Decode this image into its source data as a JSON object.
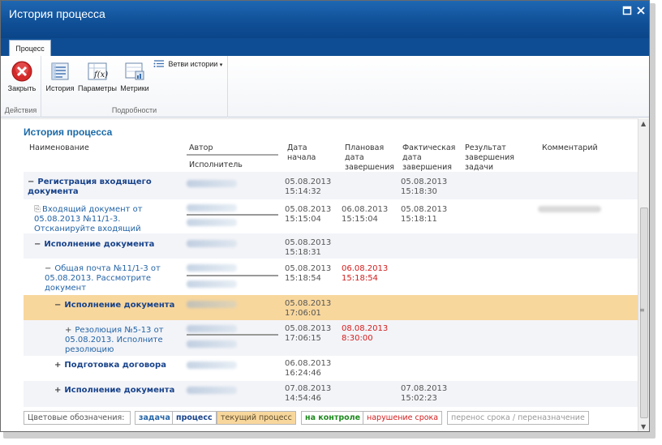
{
  "window": {
    "title": "История процесса"
  },
  "tabs": [
    {
      "label": "Процесс"
    }
  ],
  "ribbon": {
    "groups": [
      {
        "label": "Действия"
      },
      {
        "label": "Подробности"
      }
    ],
    "buttons": {
      "close": "Закрыть",
      "history": "История",
      "params": "Параметры",
      "metrics": "Метрики",
      "branches": "Ветви истории"
    }
  },
  "section_title": "История процесса",
  "columns": {
    "name": "Наименование",
    "author": "Автор",
    "executor": "Исполнитель",
    "start": "Дата начала",
    "planned": "Плановая дата завершения",
    "actual": "Фактическая дата завершения",
    "result": "Результат завершения задачи",
    "comment": "Комментарий"
  },
  "rows": [
    {
      "toggle": "−",
      "name": "Регистрация входящего документа",
      "start": "05.08.2013 15:14:32",
      "planned": "",
      "actual": "05.08.2013 15:18:30",
      "comment": ""
    },
    {
      "toggle": "",
      "name": "Входящий документ от 05.08.2013 №11/1-3. Отсканируйте входящий документ",
      "start": "05.08.2013 15:15:04",
      "planned": "06.08.2013 15:15:04",
      "actual": "05.08.2013 15:18:11",
      "comment": "scan.pnbrapfan"
    },
    {
      "toggle": "−",
      "name": "Исполнение документа",
      "start": "05.08.2013 15:18:31",
      "planned": "",
      "actual": "",
      "comment": ""
    },
    {
      "toggle": "−",
      "name": "Общая почта №11/1-3 от 05.08.2013. Рассмотрите документ",
      "start": "05.08.2013 15:18:54",
      "planned": "06.08.2013 15:18:54",
      "actual": "",
      "comment": ""
    },
    {
      "toggle": "−",
      "name": "Исполнение документа",
      "start": "05.08.2013 17:06:01",
      "planned": "",
      "actual": "",
      "comment": ""
    },
    {
      "toggle": "+",
      "name": "Резолюция №5-13 от 05.08.2013. Исполните резолюцию",
      "start": "05.08.2013 17:06:15",
      "planned": "08.08.2013 8:30:00",
      "actual": "",
      "comment": ""
    },
    {
      "toggle": "+",
      "name": "Подготовка договора",
      "start": "06.08.2013 16:24:46",
      "planned": "",
      "actual": "",
      "comment": ""
    },
    {
      "toggle": "+",
      "name": "Исполнение документа",
      "start": "07.08.2013 14:54:46",
      "planned": "",
      "actual": "07.08.2013 15:02:23",
      "comment": ""
    }
  ],
  "legend": {
    "label": "Цветовые обозначения:",
    "items": [
      {
        "text": "задача",
        "color": "#2464a6"
      },
      {
        "text": "процесс",
        "color": "#17428a"
      },
      {
        "text": "текущий процесс",
        "color": "#5a4a2a"
      },
      {
        "text": "на контроле",
        "color": "#1e8a1e"
      },
      {
        "text": "нарушение срока",
        "color": "#d31d1d"
      },
      {
        "text": "перенос срока / переназначение",
        "color": "#999999"
      }
    ]
  },
  "colors": {
    "titlebar": "#0f4f96",
    "current_process_bg": "#f8d79d",
    "link": "#2464a6",
    "overdue": "#d31d1d"
  }
}
